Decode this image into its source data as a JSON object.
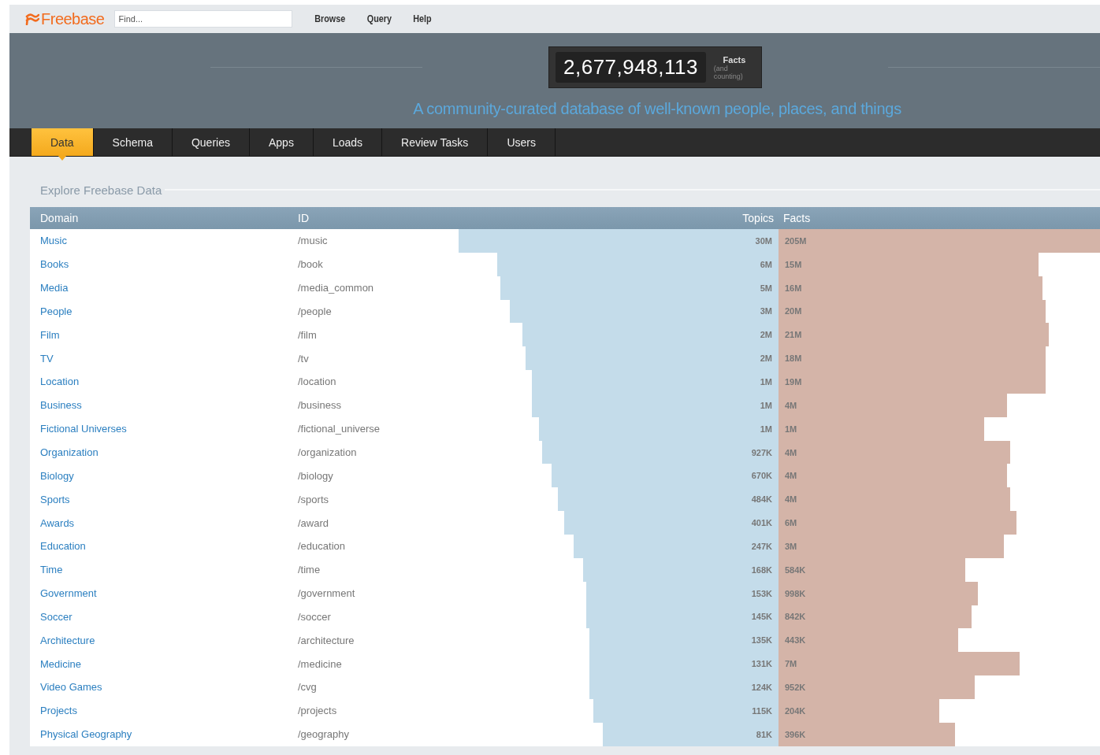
{
  "top_bar": {
    "logo": "Freebase",
    "search": {
      "placeholder": "Find..."
    },
    "links": [
      "Browse",
      "Query",
      "Help"
    ]
  },
  "hero": {
    "counter": "2,677,948,113",
    "counter_label": "Facts",
    "counter_note": "(and counting)",
    "tagline": "A community-curated database of well-known people, places, and things"
  },
  "tabs": [
    {
      "label": "Data",
      "selected": true
    },
    {
      "label": "Schema",
      "selected": false
    },
    {
      "label": "Queries",
      "selected": false
    },
    {
      "label": "Apps",
      "selected": false
    },
    {
      "label": "Loads",
      "selected": false
    },
    {
      "label": "Review Tasks",
      "selected": false
    },
    {
      "label": "Users",
      "selected": false
    }
  ],
  "section_title": "Explore Freebase Data",
  "table": {
    "columns": [
      "Domain",
      "ID",
      "Topics",
      "Facts"
    ],
    "rows": [
      {
        "domain": "Music",
        "id": "/music",
        "topics": "30M",
        "topics_level": {
          "level": 1.0
        },
        "facts": "205M",
        "facts_level": {
          "level": 1.0
        }
      },
      {
        "domain": "Books",
        "id": "/book",
        "topics": "6M",
        "topics_level": {
          "level": 0.88
        },
        "facts": "15M",
        "facts_level": {
          "level": 0.81
        }
      },
      {
        "domain": "Media",
        "id": "/media_common",
        "topics": "5M",
        "topics_level": {
          "level": 0.87
        },
        "facts": "16M",
        "facts_level": {
          "level": 0.82
        }
      },
      {
        "domain": "People",
        "id": "/people",
        "topics": "3M",
        "topics_level": {
          "level": 0.84
        },
        "facts": "20M",
        "facts_level": {
          "level": 0.83
        }
      },
      {
        "domain": "Film",
        "id": "/film",
        "topics": "2M",
        "topics_level": {
          "level": 0.8
        },
        "facts": "21M",
        "facts_level": {
          "level": 0.84
        }
      },
      {
        "domain": "TV",
        "id": "/tv",
        "topics": "2M",
        "topics_level": {
          "level": 0.79
        },
        "facts": "18M",
        "facts_level": {
          "level": 0.83
        }
      },
      {
        "domain": "Location",
        "id": "/location",
        "topics": "1M",
        "topics_level": {
          "level": 0.77
        },
        "facts": "19M",
        "facts_level": {
          "level": 0.83
        }
      },
      {
        "domain": "Business",
        "id": "/business",
        "topics": "1M",
        "topics_level": {
          "level": 0.77
        },
        "facts": "4M",
        "facts_level": {
          "level": 0.71
        }
      },
      {
        "domain": "Fictional Universes",
        "id": "/fictional_universe",
        "topics": "1M",
        "topics_level": {
          "level": 0.75
        },
        "facts": "1M",
        "facts_level": {
          "level": 0.64
        }
      },
      {
        "domain": "Organization",
        "id": "/organization",
        "topics": "927K",
        "topics_level": {
          "level": 0.74
        },
        "facts": "4M",
        "facts_level": {
          "level": 0.72
        }
      },
      {
        "domain": "Biology",
        "id": "/biology",
        "topics": "670K",
        "topics_level": {
          "level": 0.71
        },
        "facts": "4M",
        "facts_level": {
          "level": 0.71
        }
      },
      {
        "domain": "Sports",
        "id": "/sports",
        "topics": "484K",
        "topics_level": {
          "level": 0.69
        },
        "facts": "4M",
        "facts_level": {
          "level": 0.72
        }
      },
      {
        "domain": "Awards",
        "id": "/award",
        "topics": "401K",
        "topics_level": {
          "level": 0.67
        },
        "facts": "6M",
        "facts_level": {
          "level": 0.74
        }
      },
      {
        "domain": "Education",
        "id": "/education",
        "topics": "247K",
        "topics_level": {
          "level": 0.64
        },
        "facts": "3M",
        "facts_level": {
          "level": 0.7
        }
      },
      {
        "domain": "Time",
        "id": "/time",
        "topics": "168K",
        "topics_level": {
          "level": 0.61
        },
        "facts": "584K",
        "facts_level": {
          "level": 0.58
        }
      },
      {
        "domain": "Government",
        "id": "/government",
        "topics": "153K",
        "topics_level": {
          "level": 0.6
        },
        "facts": "998K",
        "facts_level": {
          "level": 0.62
        }
      },
      {
        "domain": "Soccer",
        "id": "/soccer",
        "topics": "145K",
        "topics_level": {
          "level": 0.6
        },
        "facts": "842K",
        "facts_level": {
          "level": 0.6
        }
      },
      {
        "domain": "Architecture",
        "id": "/architecture",
        "topics": "135K",
        "topics_level": {
          "level": 0.59
        },
        "facts": "443K",
        "facts_level": {
          "level": 0.56
        }
      },
      {
        "domain": "Medicine",
        "id": "/medicine",
        "topics": "131K",
        "topics_level": {
          "level": 0.59
        },
        "facts": "7M",
        "facts_level": {
          "level": 0.75
        }
      },
      {
        "domain": "Video Games",
        "id": "/cvg",
        "topics": "124K",
        "topics_level": {
          "level": 0.59
        },
        "facts": "952K",
        "facts_level": {
          "level": 0.61
        }
      },
      {
        "domain": "Projects",
        "id": "/projects",
        "topics": "115K",
        "topics_level": {
          "level": 0.58
        },
        "facts": "204K",
        "facts_level": {
          "level": 0.5
        }
      },
      {
        "domain": "Physical Geography",
        "id": "/geography",
        "topics": "81K",
        "topics_level": {
          "level": 0.55
        },
        "facts": "396K",
        "facts_level": {
          "level": 0.55
        }
      }
    ]
  }
}
